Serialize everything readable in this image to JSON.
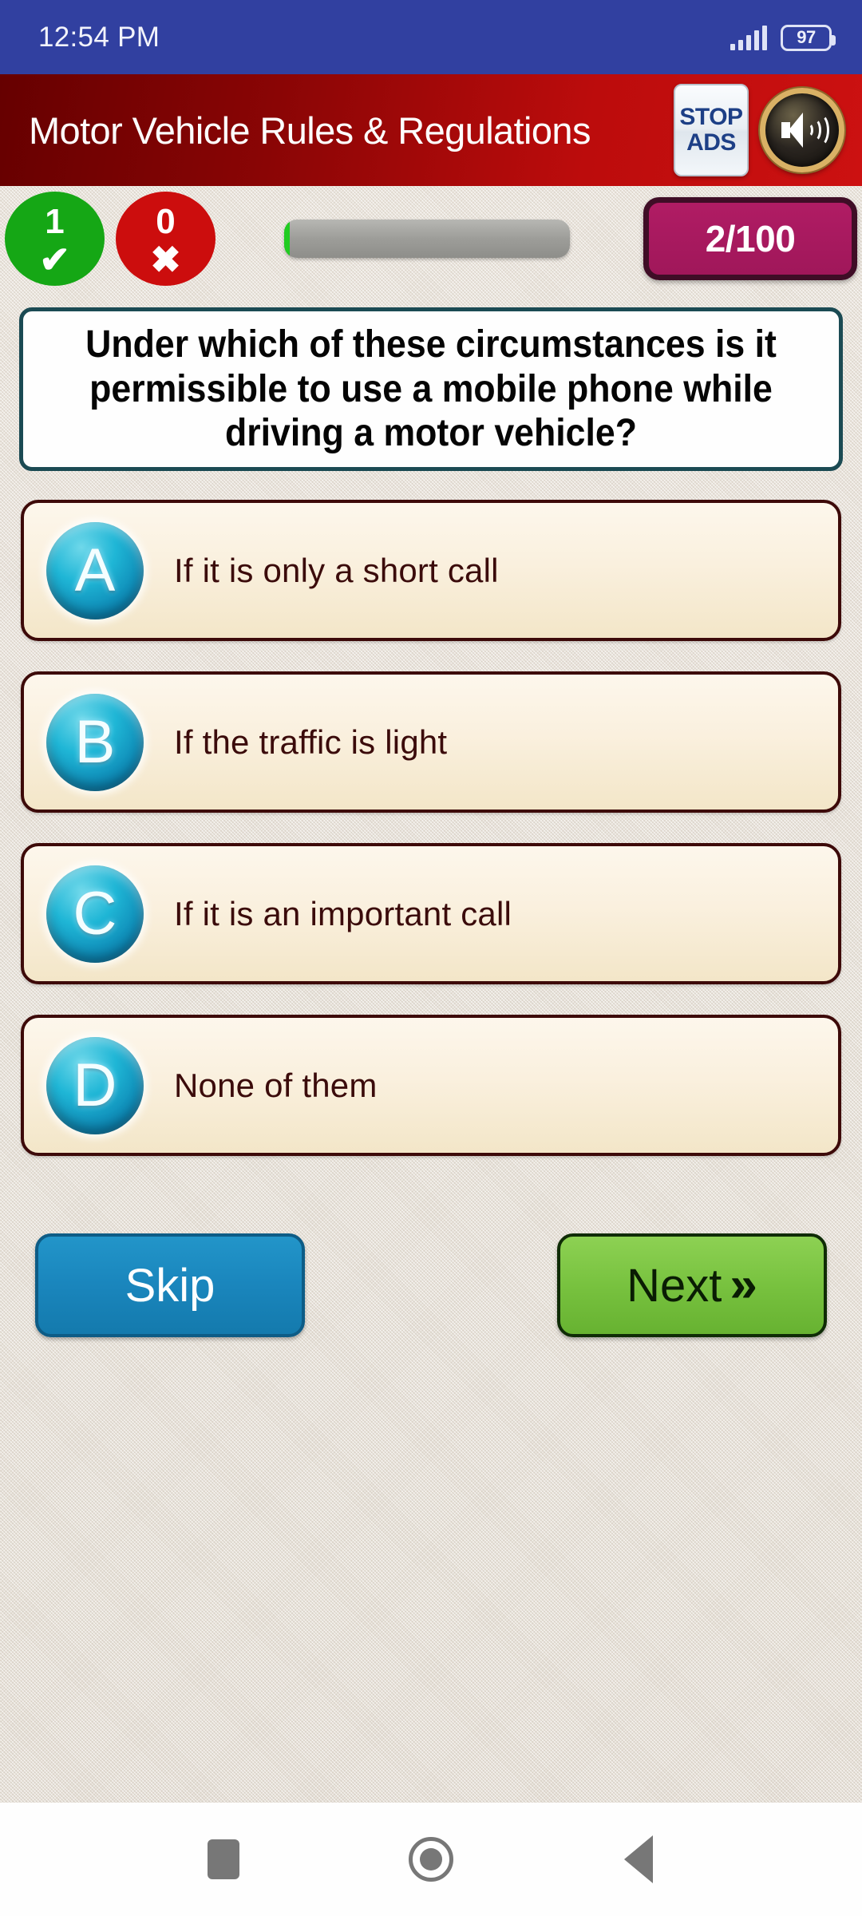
{
  "status_bar": {
    "time": "12:54 PM",
    "battery_percent": "97",
    "signal_icon": "signal-bars-icon",
    "battery_icon": "battery-icon"
  },
  "header": {
    "title": "Motor Vehicle Rules & Regulations",
    "stop_ads_line1": "STOP",
    "stop_ads_line2": "ADS",
    "sound_icon": "speaker-on-icon"
  },
  "score": {
    "correct_count": "1",
    "correct_mark": "✔",
    "wrong_count": "0",
    "wrong_mark": "✖",
    "progress_percent": 2,
    "question_counter": "2/100",
    "correct_color": "#15a715",
    "wrong_color": "#cc0d0d",
    "counter_color": "#a0175a",
    "progress_fill_color": "#21cc21"
  },
  "question": {
    "text": "Under which of these circumstances is it permissible to use a mobile phone while driving a motor vehicle?"
  },
  "options": [
    {
      "letter": "A",
      "text": "If it is only a short call"
    },
    {
      "letter": "B",
      "text": "If the traffic is light"
    },
    {
      "letter": "C",
      "text": "If it is an important call"
    },
    {
      "letter": "D",
      "text": "None of them"
    }
  ],
  "actions": {
    "skip_label": "Skip",
    "next_label": "Next",
    "next_chevron": "»",
    "skip_color": "#1a86bd",
    "next_color": "#78c23f"
  },
  "nav_bar": {
    "recents_icon": "square-recents-icon",
    "home_icon": "circle-home-icon",
    "back_icon": "triangle-back-icon"
  }
}
